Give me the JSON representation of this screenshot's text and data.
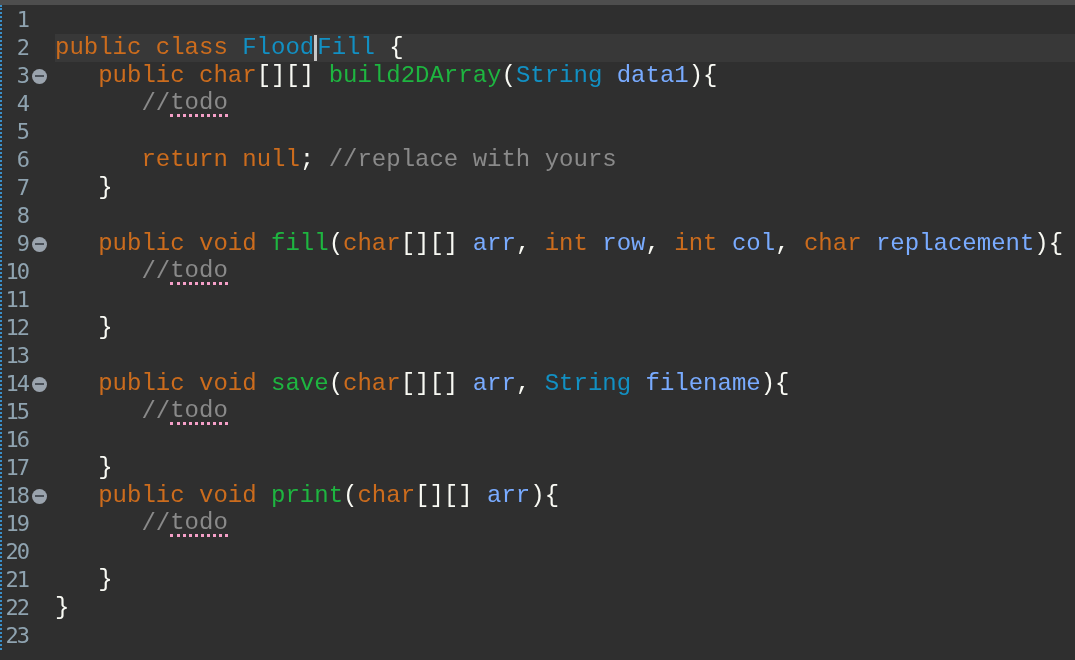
{
  "editor": {
    "lines": [
      {
        "number": "1"
      },
      {
        "number": "2",
        "current": true,
        "tokens": [
          {
            "text": "public class",
            "kind": "keyword"
          },
          {
            "text": "Flood",
            "kind": "type",
            "sp": true,
            "caret": true
          },
          {
            "text": "Fill",
            "kind": "type"
          },
          {
            "text": "{",
            "kind": "punct",
            "sp": true
          }
        ],
        "children": [
          {
            "number": "3",
            "fold": true,
            "tokens": [
              {
                "text": "public char",
                "kind": "keyword"
              },
              {
                "text": "[][]",
                "kind": "punct"
              },
              {
                "text": "build2DArray",
                "kind": "method",
                "sp": true
              },
              {
                "text": "(",
                "kind": "punct"
              },
              {
                "text": "String",
                "kind": "type"
              },
              {
                "text": "data1",
                "kind": "param",
                "sp": true
              },
              {
                "text": "){",
                "kind": "punct"
              }
            ],
            "children": [
              {
                "number": "4",
                "tokens": [
                  {
                    "text": "//",
                    "kind": "comment"
                  },
                  {
                    "text": "todo",
                    "kind": "misspelled"
                  }
                ]
              },
              {
                "number": "5"
              },
              {
                "number": "6",
                "tokens": [
                  {
                    "text": "return null",
                    "kind": "keyword"
                  },
                  {
                    "text": ";",
                    "kind": "punct"
                  },
                  {
                    "text": "//replace with yours",
                    "kind": "comment",
                    "sp": true
                  }
                ]
              }
            ]
          },
          {
            "number": "7",
            "tokens": [
              {
                "text": "}",
                "kind": "punct"
              }
            ]
          },
          {
            "number": "8"
          },
          {
            "number": "9",
            "fold": true,
            "tokens": [
              {
                "text": "public void",
                "kind": "keyword"
              },
              {
                "text": "fill",
                "kind": "method",
                "sp": true
              },
              {
                "text": "(",
                "kind": "punct"
              },
              {
                "text": "char",
                "kind": "keyword"
              },
              {
                "text": "[][]",
                "kind": "punct"
              },
              {
                "text": "arr",
                "kind": "param",
                "sp": true
              },
              {
                "text": ",",
                "kind": "punct"
              },
              {
                "text": "int",
                "kind": "keyword",
                "sp": true
              },
              {
                "text": "row",
                "kind": "param",
                "sp": true
              },
              {
                "text": ",",
                "kind": "punct"
              },
              {
                "text": "int",
                "kind": "keyword",
                "sp": true
              },
              {
                "text": "col",
                "kind": "param",
                "sp": true
              },
              {
                "text": ",",
                "kind": "punct"
              },
              {
                "text": "char",
                "kind": "keyword",
                "sp": true
              },
              {
                "text": "replacement",
                "kind": "param",
                "sp": true
              },
              {
                "text": "){",
                "kind": "punct"
              }
            ],
            "children": [
              {
                "number": "10",
                "tokens": [
                  {
                    "text": "//",
                    "kind": "comment"
                  },
                  {
                    "text": "todo",
                    "kind": "misspelled"
                  }
                ]
              },
              {
                "number": "11"
              }
            ]
          },
          {
            "number": "12",
            "tokens": [
              {
                "text": "}",
                "kind": "punct"
              }
            ]
          },
          {
            "number": "13"
          },
          {
            "number": "14",
            "fold": true,
            "tokens": [
              {
                "text": "public void",
                "kind": "keyword"
              },
              {
                "text": "save",
                "kind": "method",
                "sp": true
              },
              {
                "text": "(",
                "kind": "punct"
              },
              {
                "text": "char",
                "kind": "keyword"
              },
              {
                "text": "[][]",
                "kind": "punct"
              },
              {
                "text": "arr",
                "kind": "param",
                "sp": true
              },
              {
                "text": ",",
                "kind": "punct"
              },
              {
                "text": "String",
                "kind": "type",
                "sp": true
              },
              {
                "text": "filename",
                "kind": "param",
                "sp": true
              },
              {
                "text": "){",
                "kind": "punct"
              }
            ],
            "children": [
              {
                "number": "15",
                "tokens": [
                  {
                    "text": "//",
                    "kind": "comment"
                  },
                  {
                    "text": "todo",
                    "kind": "misspelled"
                  }
                ]
              },
              {
                "number": "16"
              }
            ]
          },
          {
            "number": "17",
            "tokens": [
              {
                "text": "}",
                "kind": "punct"
              }
            ]
          },
          {
            "number": "18",
            "fold": true,
            "tokens": [
              {
                "text": "public void",
                "kind": "keyword"
              },
              {
                "text": "print",
                "kind": "method",
                "sp": true
              },
              {
                "text": "(",
                "kind": "punct"
              },
              {
                "text": "char",
                "kind": "keyword"
              },
              {
                "text": "[][]",
                "kind": "punct"
              },
              {
                "text": "arr",
                "kind": "param",
                "sp": true
              },
              {
                "text": "){",
                "kind": "punct"
              }
            ],
            "children": [
              {
                "number": "19",
                "tokens": [
                  {
                    "text": "//",
                    "kind": "comment"
                  },
                  {
                    "text": "todo",
                    "kind": "misspelled"
                  }
                ]
              },
              {
                "number": "20"
              }
            ]
          },
          {
            "number": "21",
            "tokens": [
              {
                "text": "}",
                "kind": "punct"
              }
            ]
          }
        ]
      },
      {
        "number": "22",
        "tokens": [
          {
            "text": "}",
            "kind": "punct"
          }
        ]
      },
      {
        "number": "23"
      }
    ]
  }
}
